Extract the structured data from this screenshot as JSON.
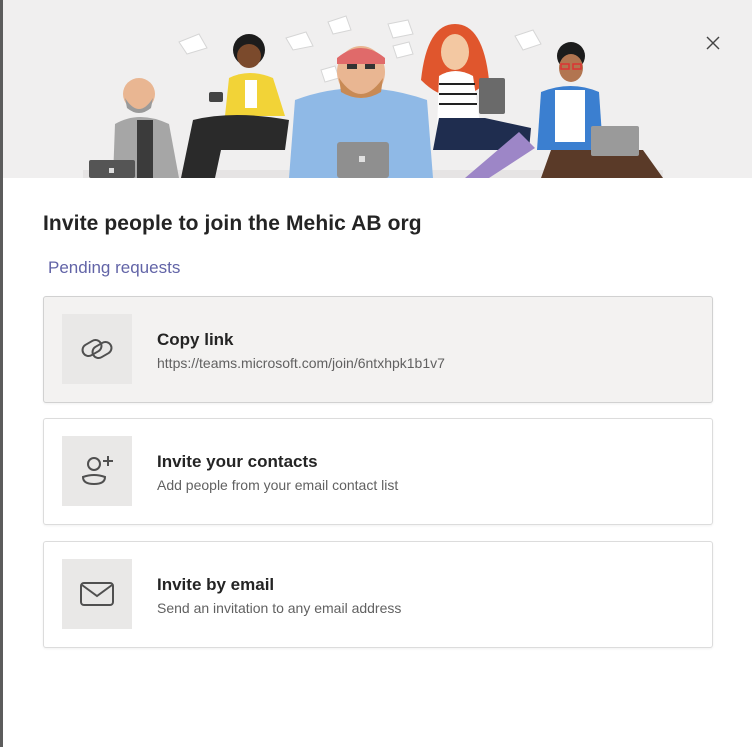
{
  "dialog": {
    "title": "Invite people to join the Mehic AB org",
    "pending_link": "Pending requests",
    "close_icon": "close-icon"
  },
  "options": [
    {
      "title": "Copy link",
      "subtitle": "https://teams.microsoft.com/join/6ntxhpk1b1v7",
      "icon": "link-icon",
      "active": true
    },
    {
      "title": "Invite your contacts",
      "subtitle": "Add people from your email contact list",
      "icon": "add-person-icon",
      "active": false
    },
    {
      "title": "Invite by email",
      "subtitle": "Send an invitation to any email address",
      "icon": "envelope-icon",
      "active": false
    }
  ],
  "colors": {
    "accent": "#6264a7",
    "hero_background": "#f0efef",
    "icon_tile": "#e9e8e7"
  }
}
